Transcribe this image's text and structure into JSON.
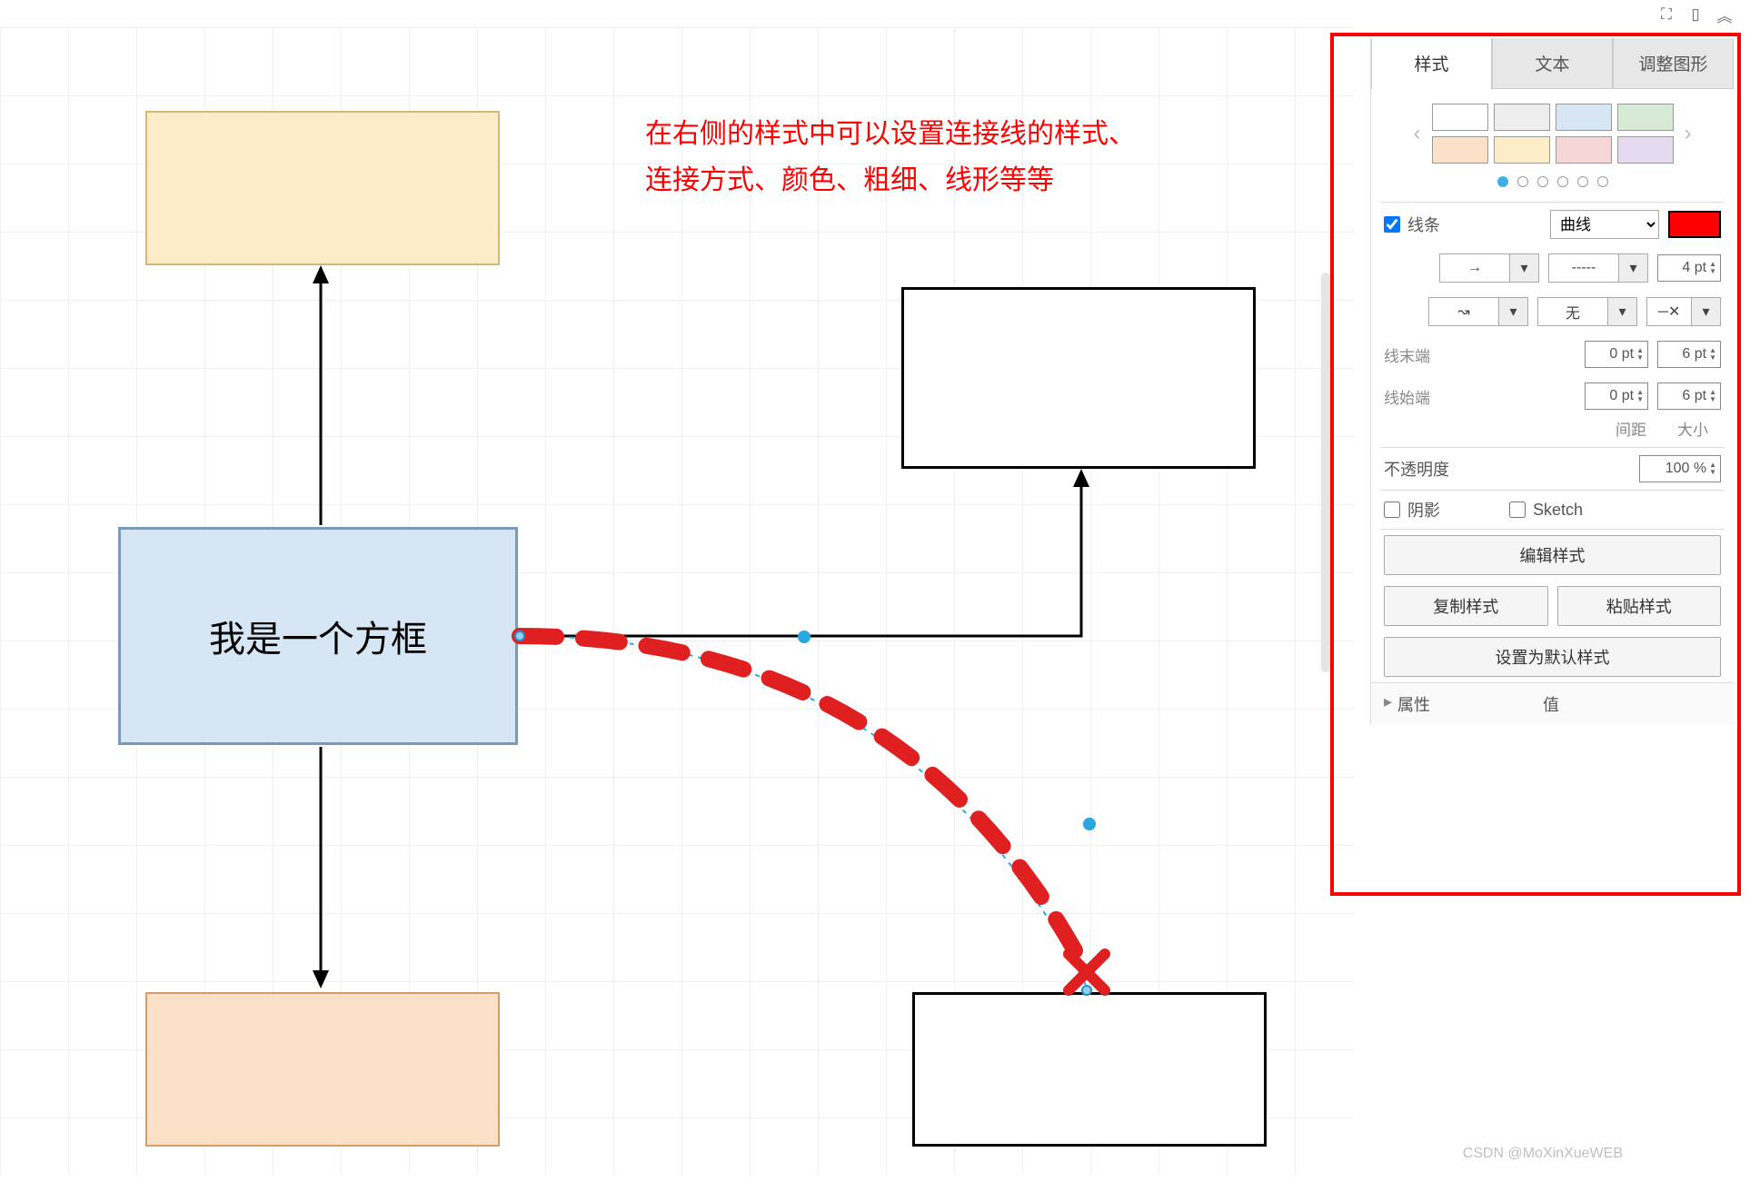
{
  "annotation": "在右侧的样式中可以设置连接线的样式、\n连接方式、颜色、粗细、线形等等",
  "shapes": {
    "blue_box_text": "我是一个方框"
  },
  "topbar_icons": [
    "fullscreen-icon",
    "panel-icon",
    "collapse-icon"
  ],
  "panel": {
    "tabs": [
      "样式",
      "文本",
      "调整图形"
    ],
    "active_tab": 0,
    "swatch_colors": [
      "#ffffff",
      "#eeeeee",
      "#d6e6f5",
      "#d7ead6",
      "#fce0c7",
      "#fcecc7",
      "#f6d6d6",
      "#e5daf0"
    ],
    "line": {
      "checkbox_label": "线条",
      "curve_type": "曲线",
      "color": "#ff0000",
      "arrow_style": "→",
      "dash_style": "- - - -",
      "dash_value": "-----",
      "width_value": "4 pt",
      "waypoint_style": "↝",
      "connection_style": "无",
      "end_marker": "⊸✕",
      "line_end_label": "线末端",
      "line_start_label": "线始端",
      "spacing_label": "间距",
      "size_label": "大小",
      "end_spacing": "0 pt",
      "end_size": "6 pt",
      "start_spacing": "0 pt",
      "start_size": "6 pt"
    },
    "opacity_label": "不透明度",
    "opacity_value": "100 %",
    "shadow_label": "阴影",
    "sketch_label": "Sketch",
    "edit_style_btn": "编辑样式",
    "copy_style_btn": "复制样式",
    "paste_style_btn": "粘贴样式",
    "default_style_btn": "设置为默认样式",
    "prop_header_attr": "属性",
    "prop_header_val": "值"
  },
  "watermark": "CSDN @MoXinXueWEB"
}
